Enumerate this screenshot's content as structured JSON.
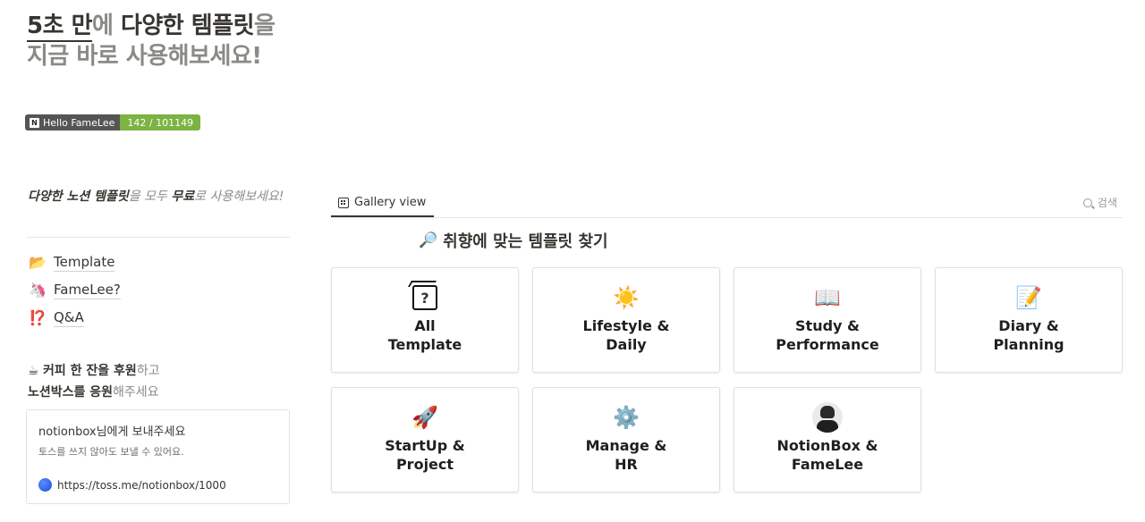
{
  "hero": {
    "line1_a": "5초 만",
    "line1_b": "에 ",
    "line1_c": "다양한 템플릿",
    "line1_d": "을",
    "line2": "지금 바로 사용해보세요!"
  },
  "badge": {
    "label": "Hello FameLee",
    "count": "142 / 101149",
    "icon": "notion-icon",
    "icon_glyph": "N"
  },
  "intro": {
    "a": "다양한 노션 템플릿",
    "b": "을 모두 ",
    "c": "무료",
    "d": "로 사용해보세요!"
  },
  "links": [
    {
      "icon": "folder-icon",
      "emoji": "📂",
      "label": "Template"
    },
    {
      "icon": "famelee-icon",
      "emoji": "🦄",
      "label": "FameLee?"
    },
    {
      "icon": "exclamation-question-icon",
      "emoji": "⁉️",
      "label": "Q&A"
    }
  ],
  "coffee": {
    "emoji": "☕",
    "a": "커피 한 잔을 후원",
    "b": "하고",
    "c": "노션박스를 응원",
    "d": "해주세요"
  },
  "support": {
    "title": "notionbox님에게 보내주세요",
    "subtitle": "토스를 쓰지 않아도 보낼 수 있어요.",
    "url": "https://toss.me/notionbox/1000"
  },
  "gallery": {
    "tab_label": "Gallery view",
    "search_label": "검색",
    "heading_emoji": "🔎",
    "heading": "취향에 맞는 템플릿 찾기",
    "cards": [
      {
        "icon": "question-box-icon",
        "glyph": "?",
        "label": "All\nTemplate"
      },
      {
        "icon": "sun-icon",
        "glyph": "☀️",
        "label": "Lifestyle &\nDaily"
      },
      {
        "icon": "book-icon",
        "glyph": "📖",
        "label": "Study &\nPerformance"
      },
      {
        "icon": "memo-icon",
        "glyph": "📝",
        "label": "Diary &\nPlanning"
      },
      {
        "icon": "rocket-icon",
        "glyph": "🚀",
        "label": "StartUp &\nProject"
      },
      {
        "icon": "gear-icon",
        "glyph": "⚙️",
        "label": "Manage &\nHR"
      },
      {
        "icon": "avatar-icon",
        "glyph": "",
        "label": "NotionBox &\nFameLee"
      }
    ]
  },
  "colors": {
    "text": "#37352f",
    "muted": "#8b8a86",
    "badge_left": "#555555",
    "badge_right": "#7cb342"
  }
}
